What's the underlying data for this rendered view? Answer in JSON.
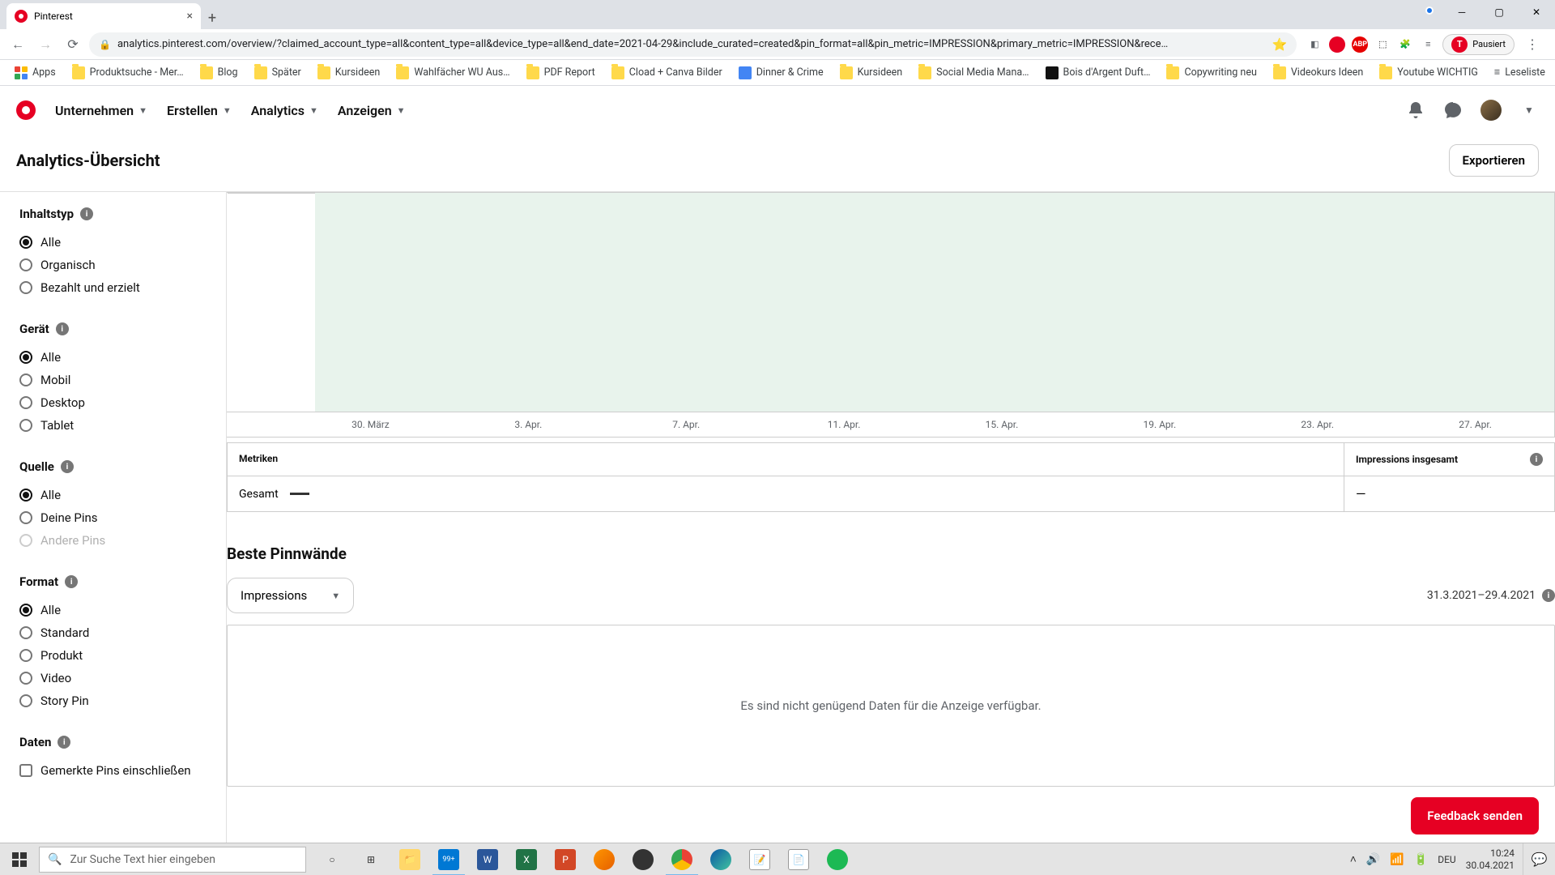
{
  "browser": {
    "tab_title": "Pinterest",
    "url": "analytics.pinterest.com/overview/?claimed_account_type=all&content_type=all&device_type=all&end_date=2021-04-29&include_curated=created&pin_format=all&pin_metric=IMPRESSION&primary_metric=IMPRESSION&rece…",
    "pause_label": "Pausiert",
    "apps_label": "Apps",
    "bookmarks": [
      "Produktsuche - Mer…",
      "Blog",
      "Später",
      "Kursideen",
      "Wahlfächer WU Aus…",
      "PDF Report",
      "Cload + Canva Bilder",
      "Dinner & Crime",
      "Kursideen",
      "Social Media Mana…",
      "Bois d'Argent Duft…",
      "Copywriting neu",
      "Videokurs Ideen",
      "Youtube WICHTIG"
    ],
    "reading_list": "Leseliste"
  },
  "header": {
    "nav": [
      "Unternehmen",
      "Erstellen",
      "Analytics",
      "Anzeigen"
    ]
  },
  "page": {
    "title": "Analytics-Übersicht",
    "export": "Exportieren"
  },
  "filters": {
    "content_type": {
      "title": "Inhaltstyp",
      "options": [
        "Alle",
        "Organisch",
        "Bezahlt und erzielt"
      ],
      "selected": 0
    },
    "device": {
      "title": "Gerät",
      "options": [
        "Alle",
        "Mobil",
        "Desktop",
        "Tablet"
      ],
      "selected": 0
    },
    "source": {
      "title": "Quelle",
      "options": [
        "Alle",
        "Deine Pins",
        "Andere Pins"
      ],
      "selected": 0,
      "disabled": [
        2
      ]
    },
    "format": {
      "title": "Format",
      "options": [
        "Alle",
        "Standard",
        "Produkt",
        "Video",
        "Story Pin"
      ],
      "selected": 0
    },
    "data": {
      "title": "Daten",
      "checkbox": "Gemerkte Pins einschließen"
    }
  },
  "chart_data": {
    "type": "area",
    "title": "",
    "xlabel": "",
    "ylabel": "",
    "x_ticks": [
      "30. März",
      "3. Apr.",
      "7. Apr.",
      "11. Apr.",
      "15. Apr.",
      "19. Apr.",
      "23. Apr.",
      "27. Apr."
    ],
    "series": [
      {
        "name": "Gesamt",
        "values": null
      }
    ],
    "note": "no data rendered"
  },
  "metrics": {
    "col_left": "Metriken",
    "col_right": "Impressions insgesamt",
    "row_label": "Gesamt",
    "row_value": "—"
  },
  "boards": {
    "title": "Beste Pinnwände",
    "select": "Impressions",
    "date_range": "31.3.2021–29.4.2021",
    "empty": "Es sind nicht genügend Daten für die Anzeige verfügbar."
  },
  "feedback": "Feedback senden",
  "taskbar": {
    "search_placeholder": "Zur Suche Text hier eingeben",
    "lang": "DEU",
    "time": "10:24",
    "date": "30.04.2021",
    "badge": "99+"
  }
}
